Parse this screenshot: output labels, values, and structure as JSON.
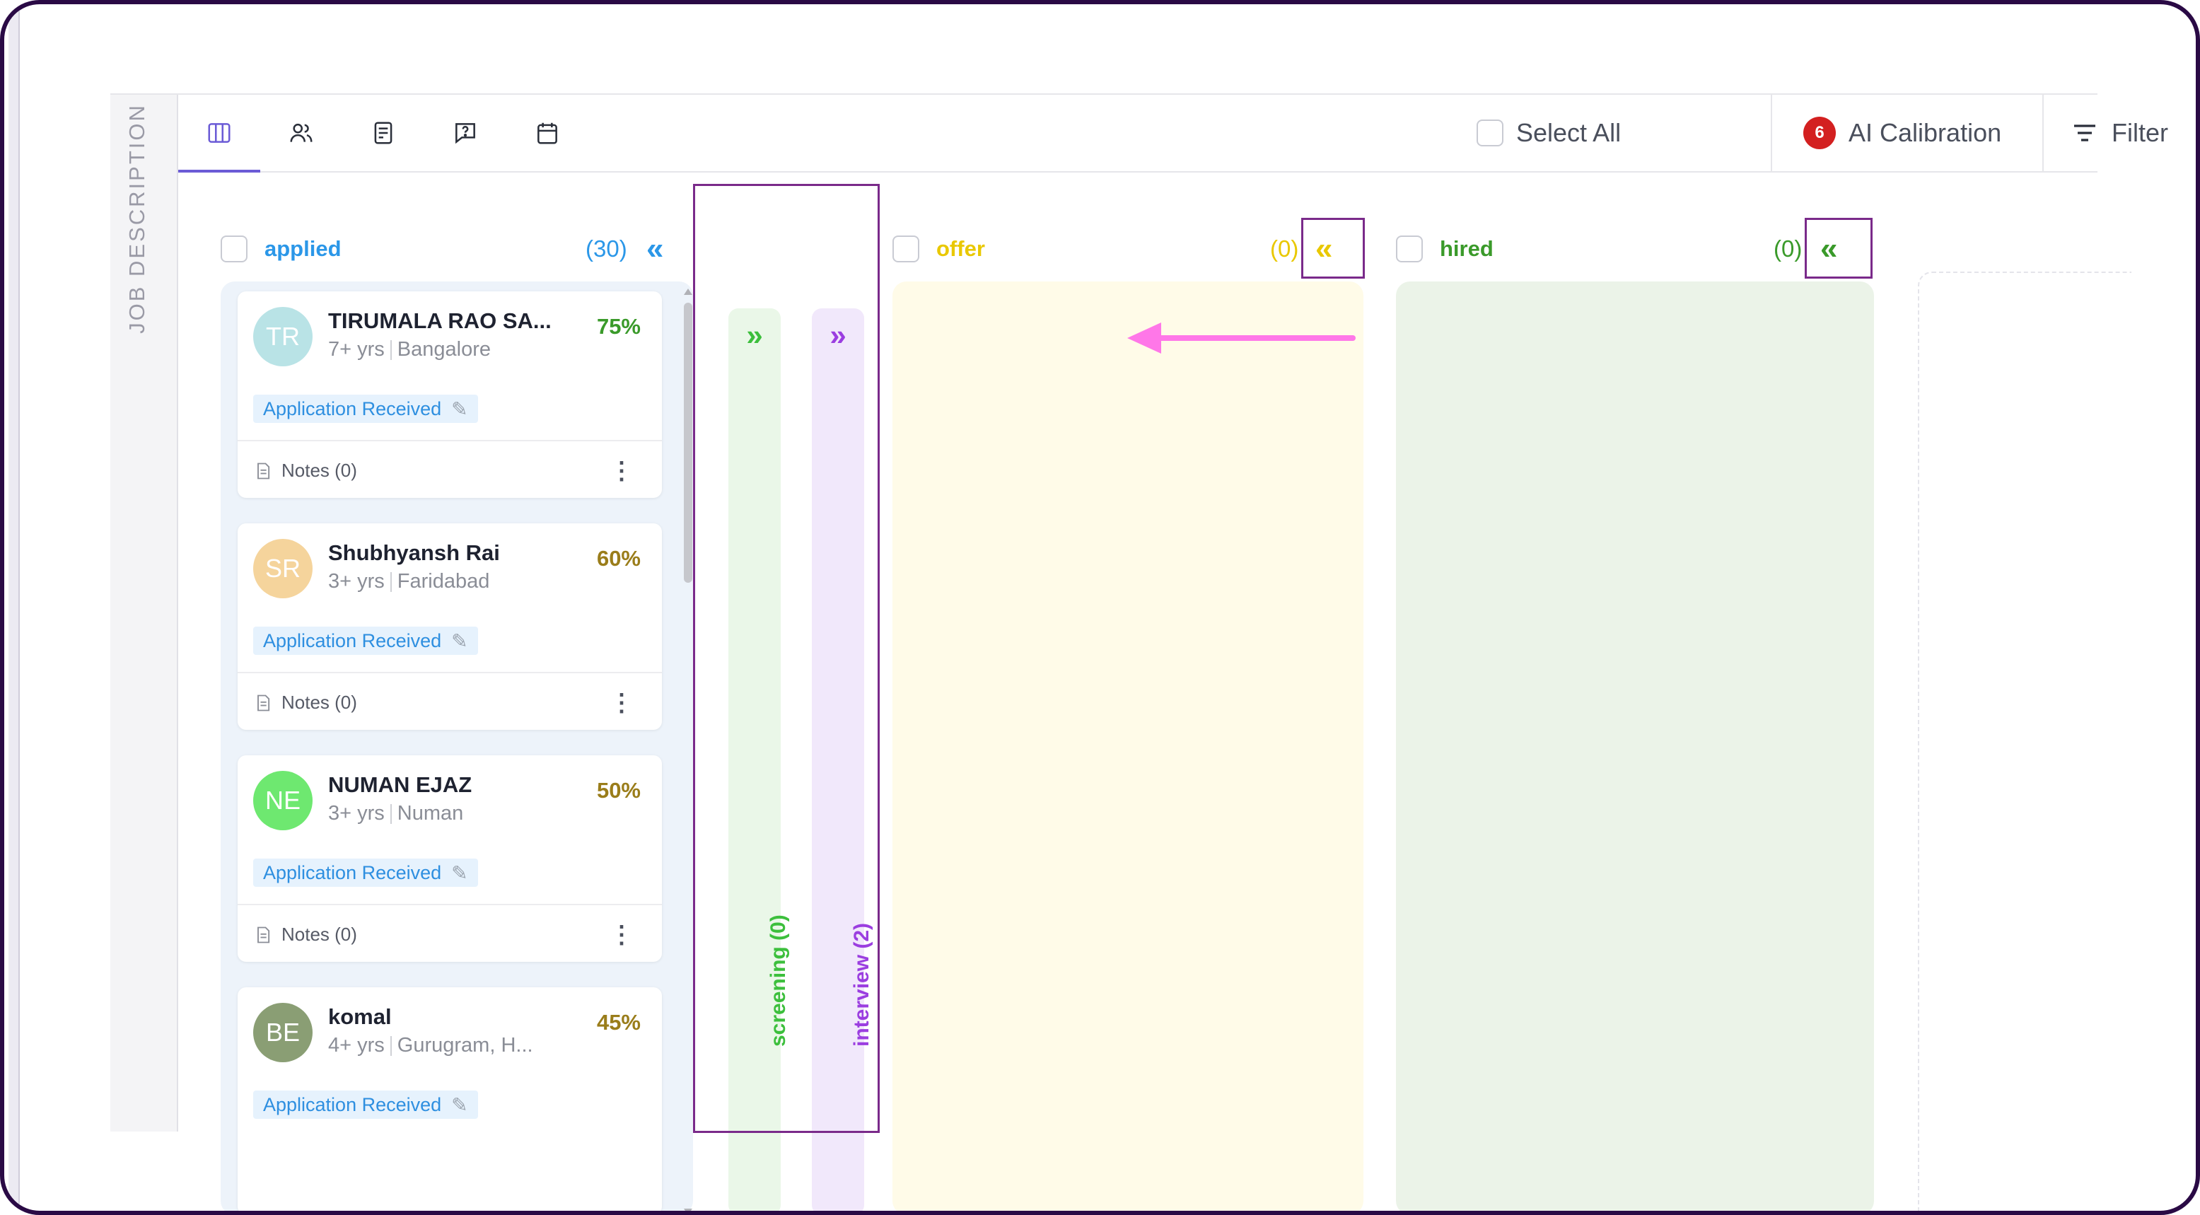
{
  "side_label": "JOB DESCRIPTION",
  "tabs": [
    {
      "name": "board-view",
      "icon": "columns-icon"
    },
    {
      "name": "candidates",
      "icon": "people-icon"
    },
    {
      "name": "notes",
      "icon": "document-icon"
    },
    {
      "name": "questions",
      "icon": "chat-question-icon"
    },
    {
      "name": "calendar",
      "icon": "calendar-icon"
    }
  ],
  "toolbar": {
    "select_all": "Select All",
    "ai_badge": "6",
    "ai_calibration": "AI Calibration",
    "filter": "Filter"
  },
  "columns": {
    "applied": {
      "name": "applied",
      "count": "(30)",
      "collapse": "«",
      "color": "#2b97e8"
    },
    "screening": {
      "label": "screening (0)",
      "arrow": "»",
      "color": "#3cbf3c",
      "bg": "#eaf7e8"
    },
    "interview": {
      "label": "interview (2)",
      "arrow": "»",
      "color": "#9b3ee0",
      "bg": "#f1e8fb"
    },
    "offer": {
      "name": "offer",
      "count": "(0)",
      "collapse": "«",
      "color": "#e9c800",
      "bg": "#fffbe8"
    },
    "hired": {
      "name": "hired",
      "count": "(0)",
      "collapse": "«",
      "color": "#3a9a2a",
      "bg": "#ebf3e8"
    }
  },
  "candidates": [
    {
      "initials": "TR",
      "name": "TIRUMALA RAO SA...",
      "exp": "7+ yrs",
      "location": "Bangalore",
      "score": "75%",
      "score_color": "#3a9a2a",
      "avatar_color": "#b9e3e6",
      "status": "Application Received",
      "notes": "Notes (0)"
    },
    {
      "initials": "SR",
      "name": "Shubhyansh Rai",
      "exp": "3+ yrs",
      "location": "Faridabad",
      "score": "60%",
      "score_color": "#9a7d1a",
      "avatar_color": "#f5d49c",
      "status": "Application Received",
      "notes": "Notes (0)"
    },
    {
      "initials": "NE",
      "name": "NUMAN EJAZ",
      "exp": "3+ yrs",
      "location": "Numan",
      "score": "50%",
      "score_color": "#9a7d1a",
      "avatar_color": "#6ee870",
      "status": "Application Received",
      "notes": "Notes (0)"
    },
    {
      "initials": "BE",
      "name": "komal",
      "exp": "4+ yrs",
      "location": "Gurugram, H...",
      "score": "45%",
      "score_color": "#9a7d1a",
      "avatar_color": "#8a9e74",
      "status": "Application Received",
      "notes": "Notes (0)"
    }
  ]
}
